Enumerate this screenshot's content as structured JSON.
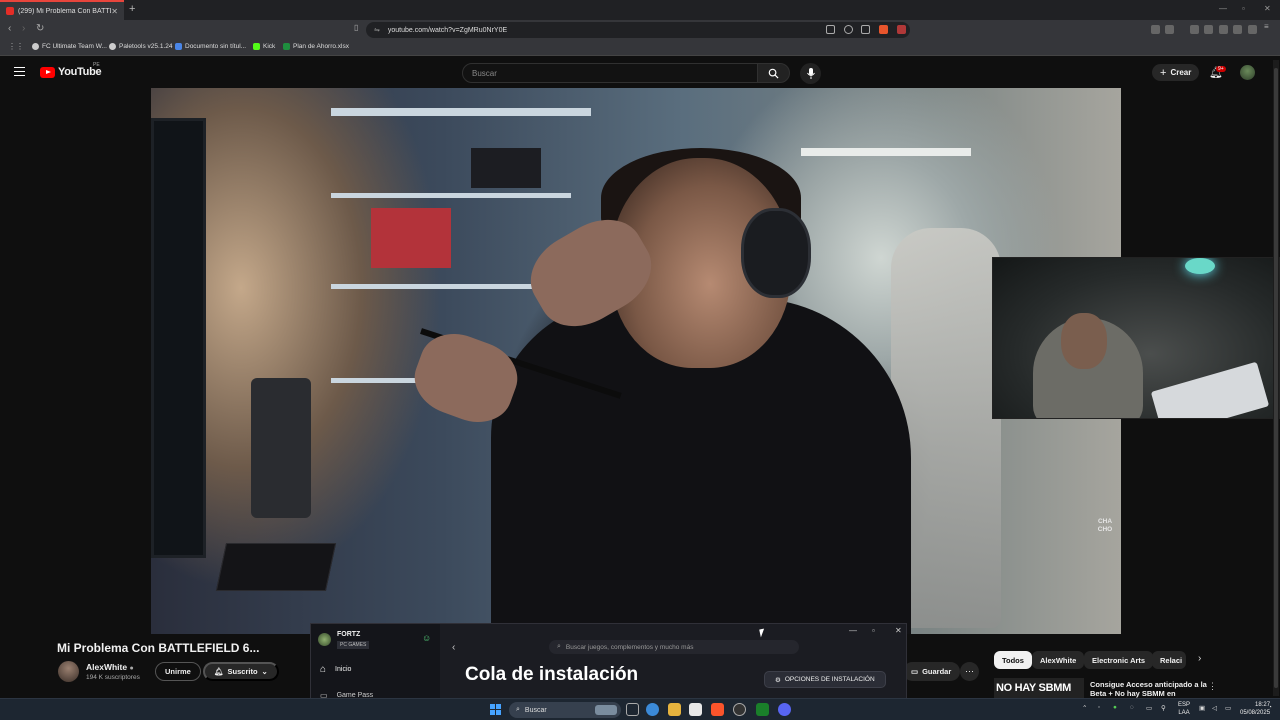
{
  "browser": {
    "tab_title": "(299) Mi Problema Con BATTL",
    "url": "youtube.com/watch?v=ZgMRu0NrY0E",
    "bookmarks": [
      "FC Ultimate Team W...",
      "Paletools v25.1.24",
      "Documento sin títul...",
      "Kick",
      "Plan de Ahorro.xlsx"
    ]
  },
  "youtube": {
    "logo_text": "YouTube",
    "country_code": "PE",
    "search_placeholder": "Buscar",
    "create_label": "Crear",
    "notification_count": "9+"
  },
  "video": {
    "title": "Mi Problema Con BATTLEFIELD 6...",
    "watermark": "CHA\nCHO"
  },
  "channel": {
    "name": "AlexWhite",
    "subscribers": "194 K suscriptores",
    "join_label": "Unirme",
    "subscribed_label": "Suscrito",
    "save_label": "Guardar"
  },
  "related": {
    "chips": [
      "Todos",
      "AlexWhite",
      "Electronic Arts",
      "Relaci"
    ],
    "thumb_text": "NO HAY SBMM",
    "title": "Consigue Acceso anticipado a la Beta + No hay SBMM en"
  },
  "ea_app": {
    "username": "FORTZ",
    "platform": "PC GAMES",
    "nav_home": "Inicio",
    "nav_second": "Game Pass",
    "search_placeholder": "Buscar juegos, complementos y mucho más",
    "title": "Cola de instalación",
    "options_label": "OPCIONES DE INSTALACIÓN"
  },
  "taskbar": {
    "search_placeholder": "Buscar",
    "lang_top": "ESP",
    "lang_bottom": "LAA",
    "time": "18:27",
    "date": "05/08/2025"
  },
  "colors": {
    "youtube_red": "#ff0000",
    "accent_blue": "#46a3ff",
    "ea_green": "#55d07a"
  }
}
